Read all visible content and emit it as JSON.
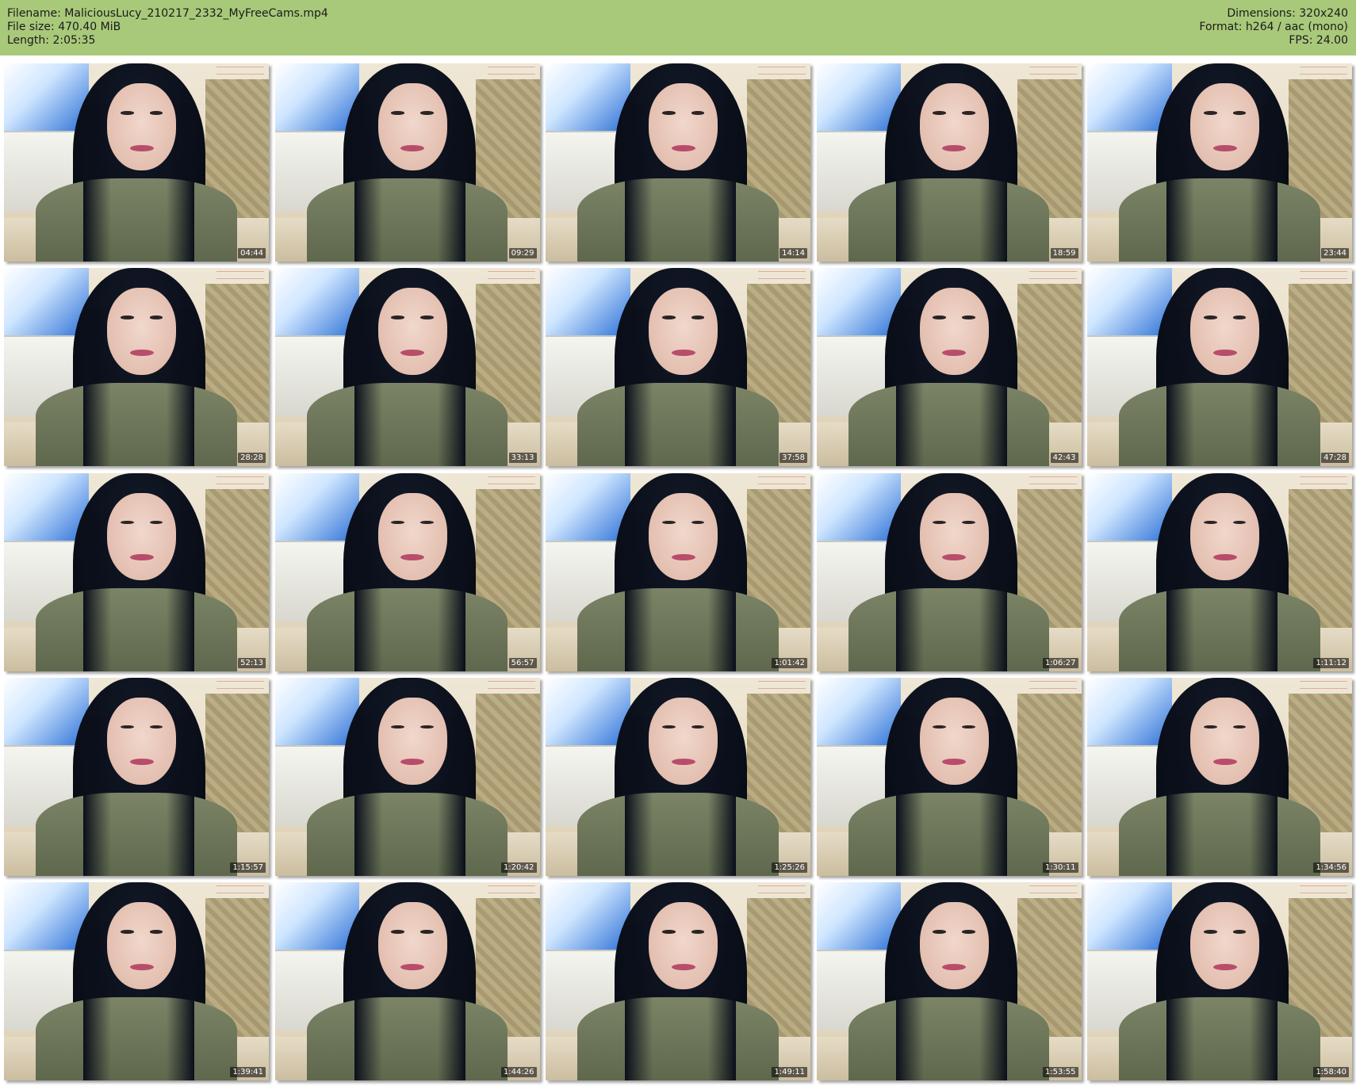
{
  "header": {
    "left": [
      "Filename: MaliciousLucy_210217_2332_MyFreeCams.mp4",
      "File size: 470.40 MiB",
      "Length: 2:05:35"
    ],
    "right": [
      "Dimensions: 320x240",
      "Format: h264 / aac (mono)",
      "FPS: 24.00"
    ]
  },
  "thumbnails": [
    {
      "timestamp": "04:44"
    },
    {
      "timestamp": "09:29"
    },
    {
      "timestamp": "14:14"
    },
    {
      "timestamp": "18:59"
    },
    {
      "timestamp": "23:44"
    },
    {
      "timestamp": "28:28"
    },
    {
      "timestamp": "33:13"
    },
    {
      "timestamp": "37:58"
    },
    {
      "timestamp": "42:43"
    },
    {
      "timestamp": "47:28"
    },
    {
      "timestamp": "52:13"
    },
    {
      "timestamp": "56:57"
    },
    {
      "timestamp": "1:01:42"
    },
    {
      "timestamp": "1:06:27"
    },
    {
      "timestamp": "1:11:12"
    },
    {
      "timestamp": "1:15:57"
    },
    {
      "timestamp": "1:20:42"
    },
    {
      "timestamp": "1:25:26"
    },
    {
      "timestamp": "1:30:11"
    },
    {
      "timestamp": "1:34:56"
    },
    {
      "timestamp": "1:39:41"
    },
    {
      "timestamp": "1:44:26"
    },
    {
      "timestamp": "1:49:11"
    },
    {
      "timestamp": "1:53:55"
    },
    {
      "timestamp": "1:58:40"
    }
  ]
}
